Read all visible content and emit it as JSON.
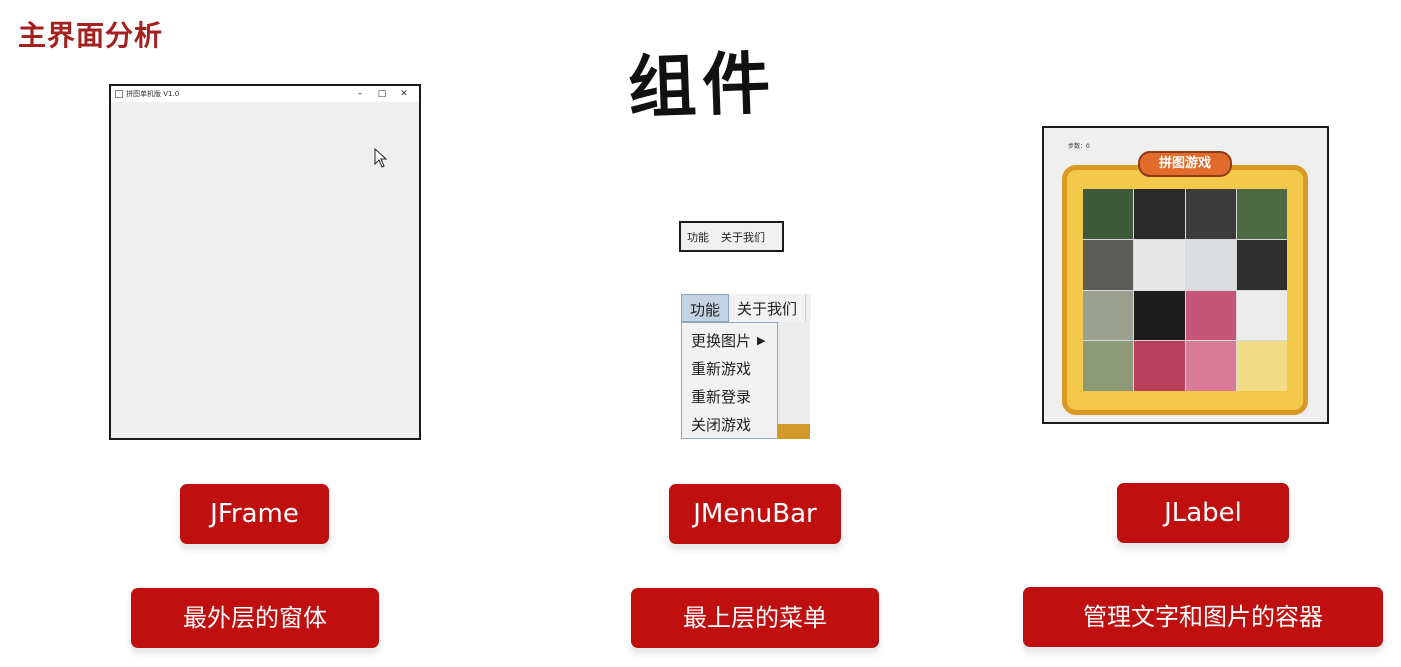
{
  "header": {
    "section_title": "主界面分析",
    "main_title": "组件"
  },
  "frame_demo": {
    "window_title": "拼图单机版 V1.0",
    "controls": [
      "–",
      "□",
      "✕"
    ]
  },
  "menubar_demo": {
    "closed_items": [
      "功能",
      "关于我们"
    ],
    "open_menus": [
      "功能",
      "关于我们"
    ],
    "dropdown_items": [
      "更换图片",
      "重新游戏",
      "重新登录",
      "关闭游戏"
    ]
  },
  "label_demo": {
    "steps_text": "步数：0",
    "banner_text": "拼图游戏"
  },
  "components": [
    {
      "class_name": "JFrame",
      "description": "最外层的窗体"
    },
    {
      "class_name": "JMenuBar",
      "description": "最上层的菜单"
    },
    {
      "class_name": "JLabel",
      "description": "管理文字和图片的容器"
    }
  ],
  "colors": {
    "accent_red": "#bf0f0f",
    "title_red": "#a42120"
  }
}
